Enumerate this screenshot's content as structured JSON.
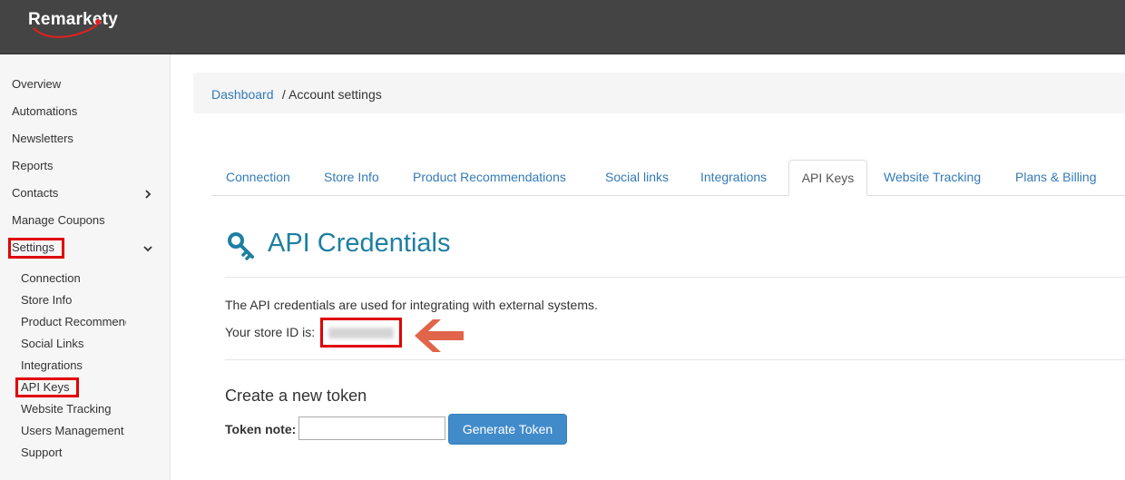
{
  "app": {
    "logo_text": "Remarkety"
  },
  "sidebar": {
    "items": [
      {
        "label": "Overview"
      },
      {
        "label": "Automations"
      },
      {
        "label": "Newsletters"
      },
      {
        "label": "Reports"
      },
      {
        "label": "Contacts"
      },
      {
        "label": "Manage Coupons"
      },
      {
        "label": "Settings"
      }
    ],
    "settings_subitems": [
      {
        "label": "Connection"
      },
      {
        "label": "Store Info"
      },
      {
        "label": "Product Recommendations"
      },
      {
        "label": "Social Links"
      },
      {
        "label": "Integrations"
      },
      {
        "label": "API Keys"
      },
      {
        "label": "Website Tracking"
      },
      {
        "label": "Users Management"
      },
      {
        "label": "Support"
      }
    ]
  },
  "breadcrumb": {
    "link": "Dashboard",
    "separator": " / ",
    "current": "Account settings"
  },
  "tabs": [
    {
      "label": "Connection"
    },
    {
      "label": "Store Info"
    },
    {
      "label": "Product Recommendations"
    },
    {
      "label": "Social links"
    },
    {
      "label": "Integrations"
    },
    {
      "label": "API Keys"
    },
    {
      "label": "Website Tracking"
    },
    {
      "label": "Plans & Billing"
    }
  ],
  "active_tab": "API Keys",
  "main": {
    "title": "API Credentials",
    "title_icon": "key-icon",
    "description": "The API credentials are used for integrating with external systems.",
    "store_id_label": "Your store ID is:",
    "token_section_title": "Create a new token",
    "token_note_label": "Token note:",
    "token_note_value": "",
    "generate_button": "Generate Token"
  },
  "colors": {
    "topbar": "#444444",
    "link": "#337ab7",
    "title": "#1e7fa2",
    "highlight": "#e00000",
    "arrow": "#e0654a",
    "button": "#428bca"
  }
}
